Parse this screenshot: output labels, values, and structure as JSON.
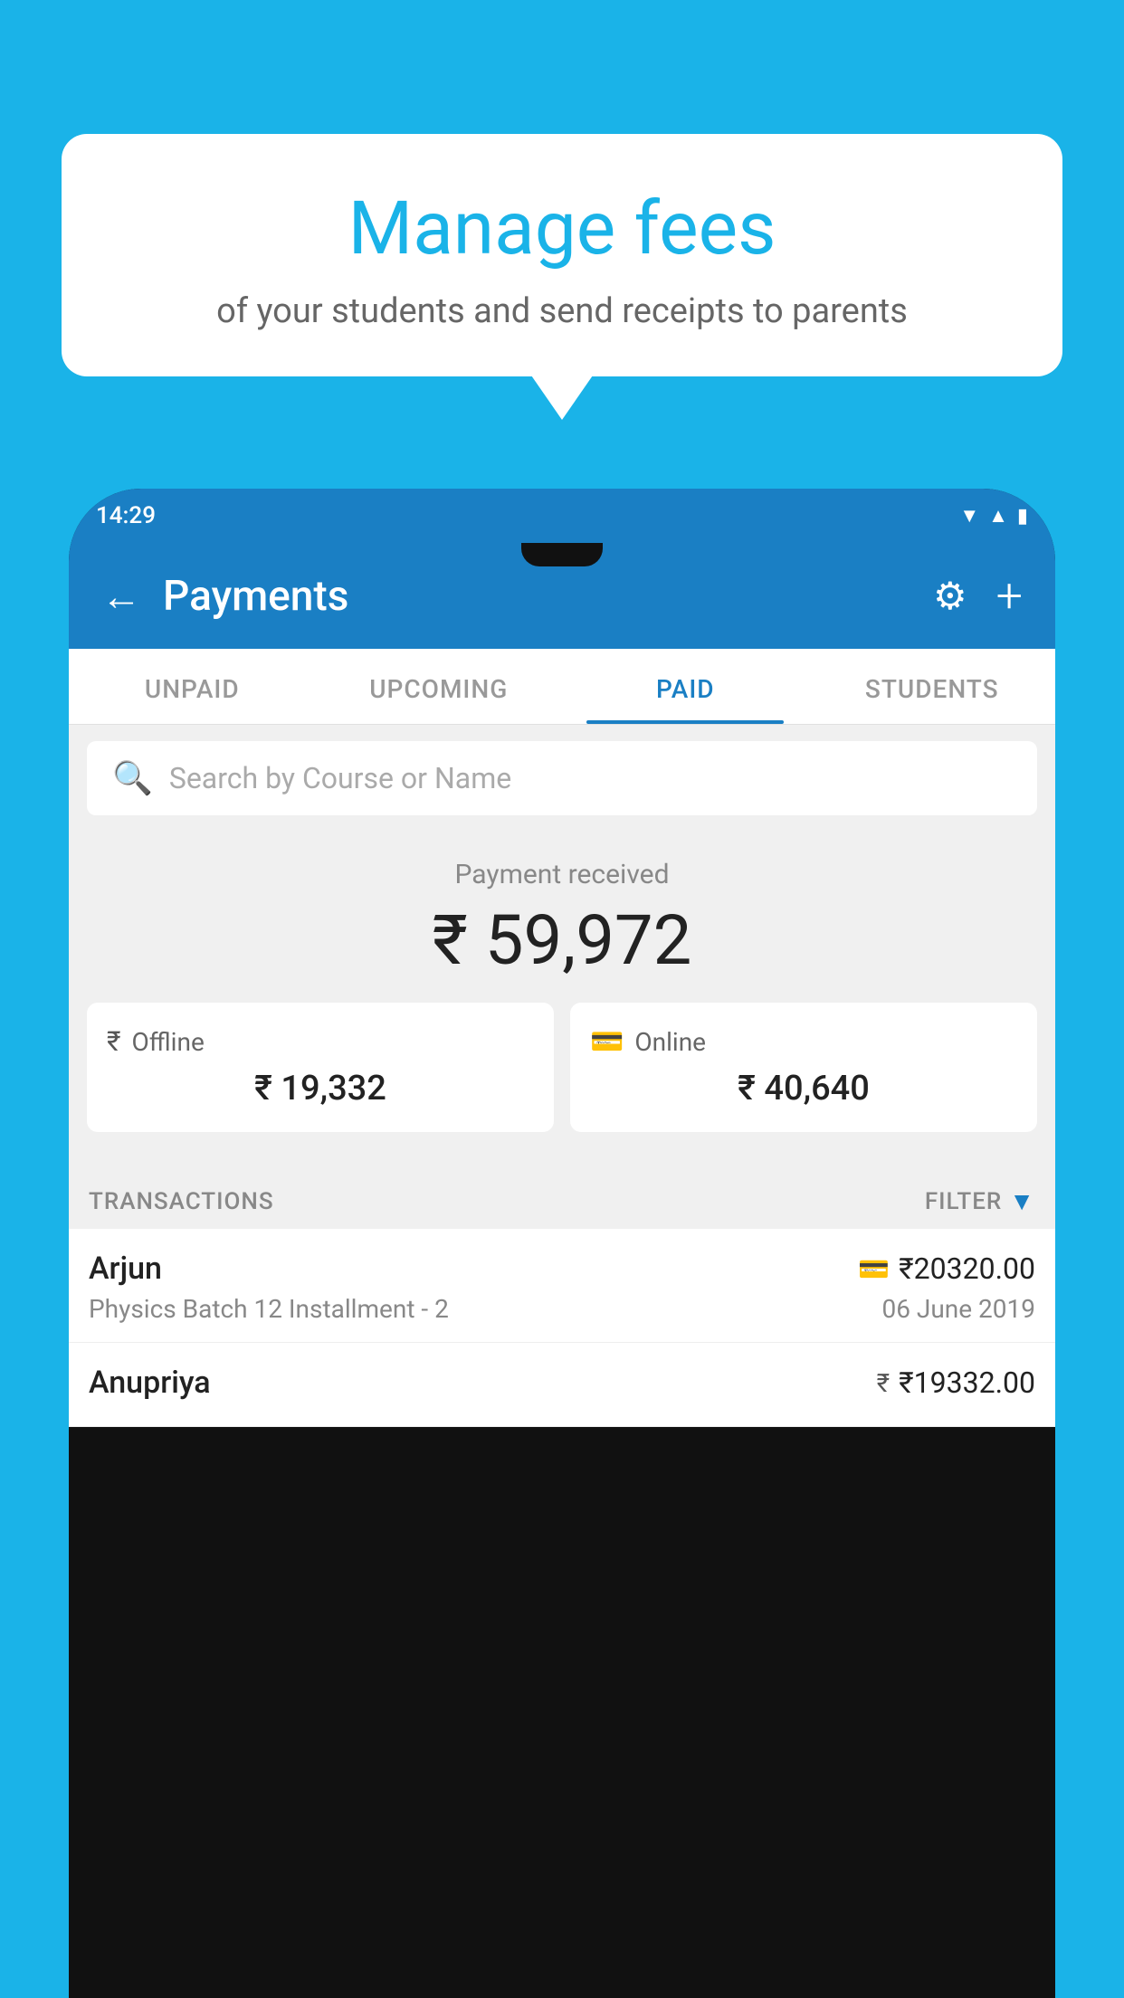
{
  "background": {
    "color": "#1ab3e8"
  },
  "speech_bubble": {
    "title": "Manage fees",
    "subtitle": "of your students and send receipts to parents"
  },
  "status_bar": {
    "time": "14:29",
    "icons": [
      "wifi",
      "signal",
      "battery"
    ]
  },
  "header": {
    "title": "Payments",
    "back_label": "←",
    "gear_label": "⚙",
    "plus_label": "+"
  },
  "tabs": [
    {
      "label": "UNPAID",
      "active": false
    },
    {
      "label": "UPCOMING",
      "active": false
    },
    {
      "label": "PAID",
      "active": true
    },
    {
      "label": "STUDENTS",
      "active": false
    }
  ],
  "search": {
    "placeholder": "Search by Course or Name"
  },
  "payment_summary": {
    "label": "Payment received",
    "amount": "₹ 59,972",
    "offline_label": "Offline",
    "offline_amount": "₹ 19,332",
    "online_label": "Online",
    "online_amount": "₹ 40,640"
  },
  "transactions_section": {
    "label": "TRANSACTIONS",
    "filter_label": "FILTER"
  },
  "transactions": [
    {
      "name": "Arjun",
      "amount": "₹20320.00",
      "course": "Physics Batch 12 Installment - 2",
      "date": "06 June 2019",
      "payment_type": "online"
    },
    {
      "name": "Anupriya",
      "amount": "₹19332.00",
      "course": "",
      "date": "",
      "payment_type": "offline"
    }
  ]
}
